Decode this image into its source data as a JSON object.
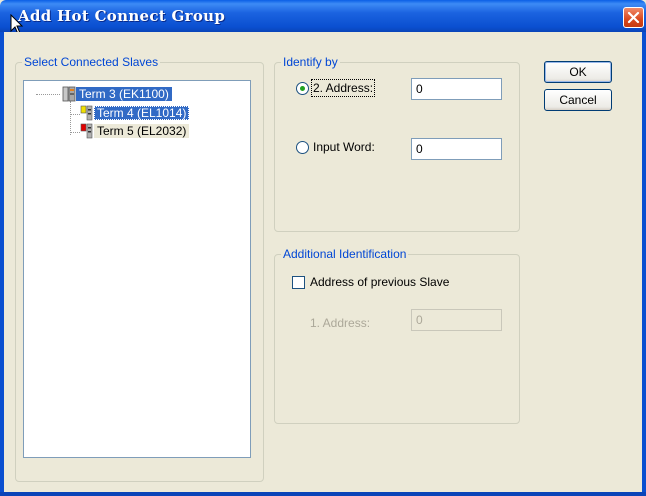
{
  "window": {
    "title": "Add Hot Connect Group"
  },
  "slaves": {
    "group_label": "Select Connected Slaves",
    "items": [
      {
        "label": "Term 3 (EK1100)",
        "icon": "coupler-icon"
      },
      {
        "label": "Term 4 (EL1014)",
        "icon": "input-terminal-icon"
      },
      {
        "label": "Term 5 (EL2032)",
        "icon": "output-terminal-icon"
      }
    ]
  },
  "identify": {
    "group_label": "Identify by",
    "address_label": "2. Address:",
    "address_value": "0",
    "input_word_label": "Input Word:",
    "input_word_value": "0"
  },
  "additional": {
    "group_label": "Additional Identification",
    "checkbox_label": "Address of previous Slave",
    "address1_label": "1. Address:",
    "address1_value": "0"
  },
  "buttons": {
    "ok": "OK",
    "cancel": "Cancel"
  },
  "colors": {
    "title_bar": "#0a4fd0",
    "selection": "#316ac5",
    "group_label": "#0046d5"
  }
}
